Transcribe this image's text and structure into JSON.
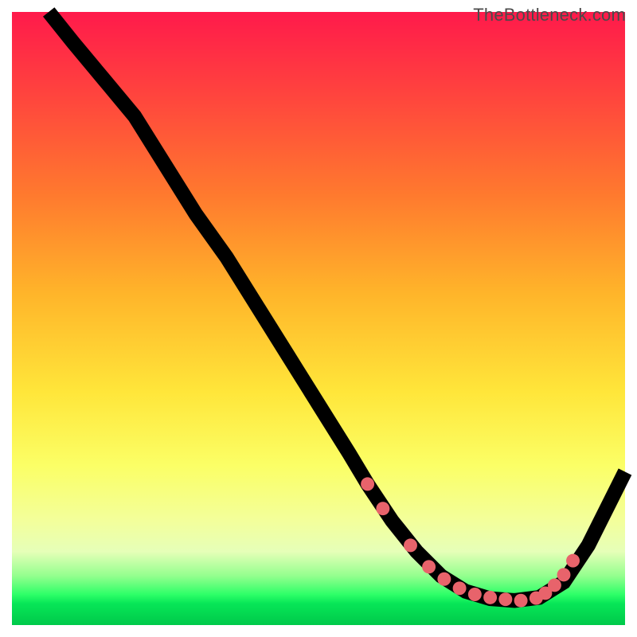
{
  "watermark": "TheBottleneck.com",
  "chart_data": {
    "type": "line",
    "title": "",
    "xlabel": "",
    "ylabel": "",
    "xlim": [
      0,
      100
    ],
    "ylim": [
      0,
      100
    ],
    "grid": false,
    "line": {
      "name": "curve",
      "x": [
        6,
        10,
        15,
        20,
        25,
        30,
        35,
        40,
        45,
        50,
        55,
        58,
        62,
        66,
        70,
        74,
        78,
        82,
        86,
        90,
        94,
        100
      ],
      "y": [
        100,
        95,
        89,
        83,
        75,
        67,
        60,
        52,
        44,
        36,
        28,
        23,
        17,
        12,
        8,
        5.5,
        4.3,
        4.0,
        4.5,
        7,
        13,
        25
      ]
    },
    "dots": {
      "name": "highlight-points",
      "color": "#e8636b",
      "x": [
        58,
        60.5,
        65,
        68,
        70.5,
        73,
        75.5,
        78,
        80.5,
        83,
        85.5,
        87,
        88.5,
        90,
        91.5
      ],
      "y": [
        23,
        19,
        13,
        9.5,
        7.5,
        6,
        5,
        4.5,
        4.2,
        4.0,
        4.4,
        5.2,
        6.5,
        8.2,
        10.5
      ]
    }
  }
}
